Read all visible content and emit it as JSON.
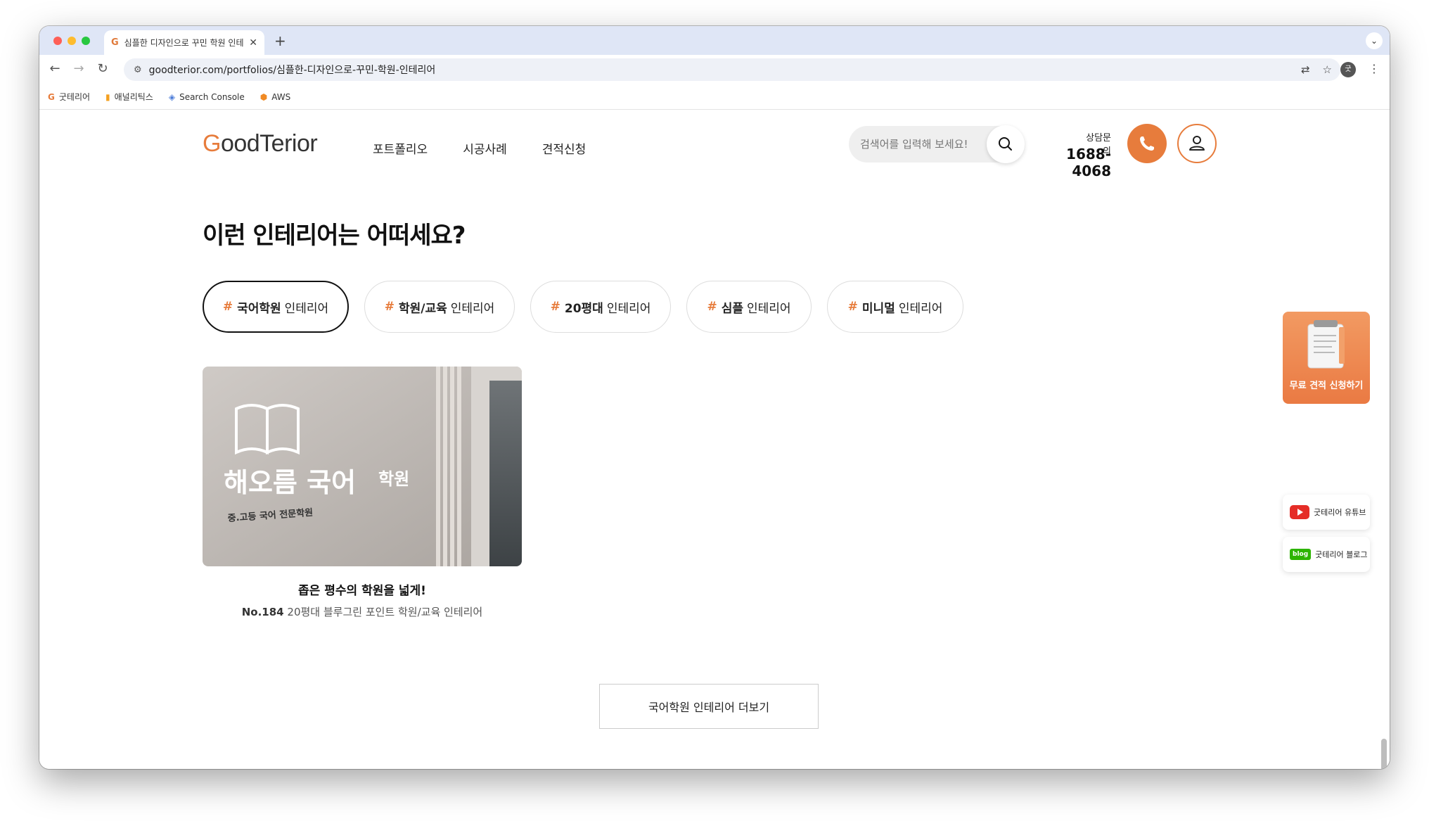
{
  "browser": {
    "tab_title": "심플한 디자인으로 꾸민 학원 인테리어",
    "new_tab": "+",
    "url": "goodterior.com/portfolios/심플한-디자인으로-꾸민-학원-인테리어",
    "bookmarks": [
      {
        "label": "굿테리어",
        "icon": "g-favicon"
      },
      {
        "label": "애널리틱스",
        "icon": "analytics-icon"
      },
      {
        "label": "Search Console",
        "icon": "search-console-icon"
      },
      {
        "label": "AWS",
        "icon": "aws-icon"
      }
    ],
    "profile_initial": "굿"
  },
  "site": {
    "logo_g": "G",
    "logo_rest": "oodTerior",
    "nav": [
      "포트폴리오",
      "시공사례",
      "견적신청"
    ],
    "search_placeholder": "검색어를 입력해 보세요!",
    "phone_label": "상담문의",
    "phone_number": "1688-4068",
    "accent": "#e77c3c"
  },
  "section": {
    "heading": "이런 인테리어는 어떠세요?",
    "chips": [
      {
        "hash": "#",
        "strong": "국어학원",
        "rest": "인테리어",
        "active": true
      },
      {
        "hash": "#",
        "strong": "학원/교육",
        "rest": "인테리어",
        "active": false
      },
      {
        "hash": "#",
        "strong": "20평대",
        "rest": "인테리어",
        "active": false
      },
      {
        "hash": "#",
        "strong": "심플",
        "rest": "인테리어",
        "active": false
      },
      {
        "hash": "#",
        "strong": "미니멀",
        "rest": "인테리어",
        "active": false
      }
    ],
    "card": {
      "sign_main": "해오름 국어",
      "sign_small": "학원",
      "sign_sub": "중.고등 국어 전문학원",
      "title": "좁은 평수의 학원을 넓게!",
      "no": "No.184",
      "desc": "20평대 블루그린 포인트 학원/교육 인테리어"
    },
    "more_button": "국어학원 인테리어 더보기"
  },
  "sidebar": {
    "quote_label": "무료 견적 신청하기",
    "youtube_label": "굿테리어 유튜브",
    "blog_badge": "blog",
    "blog_label": "굿테리어 블로그"
  }
}
